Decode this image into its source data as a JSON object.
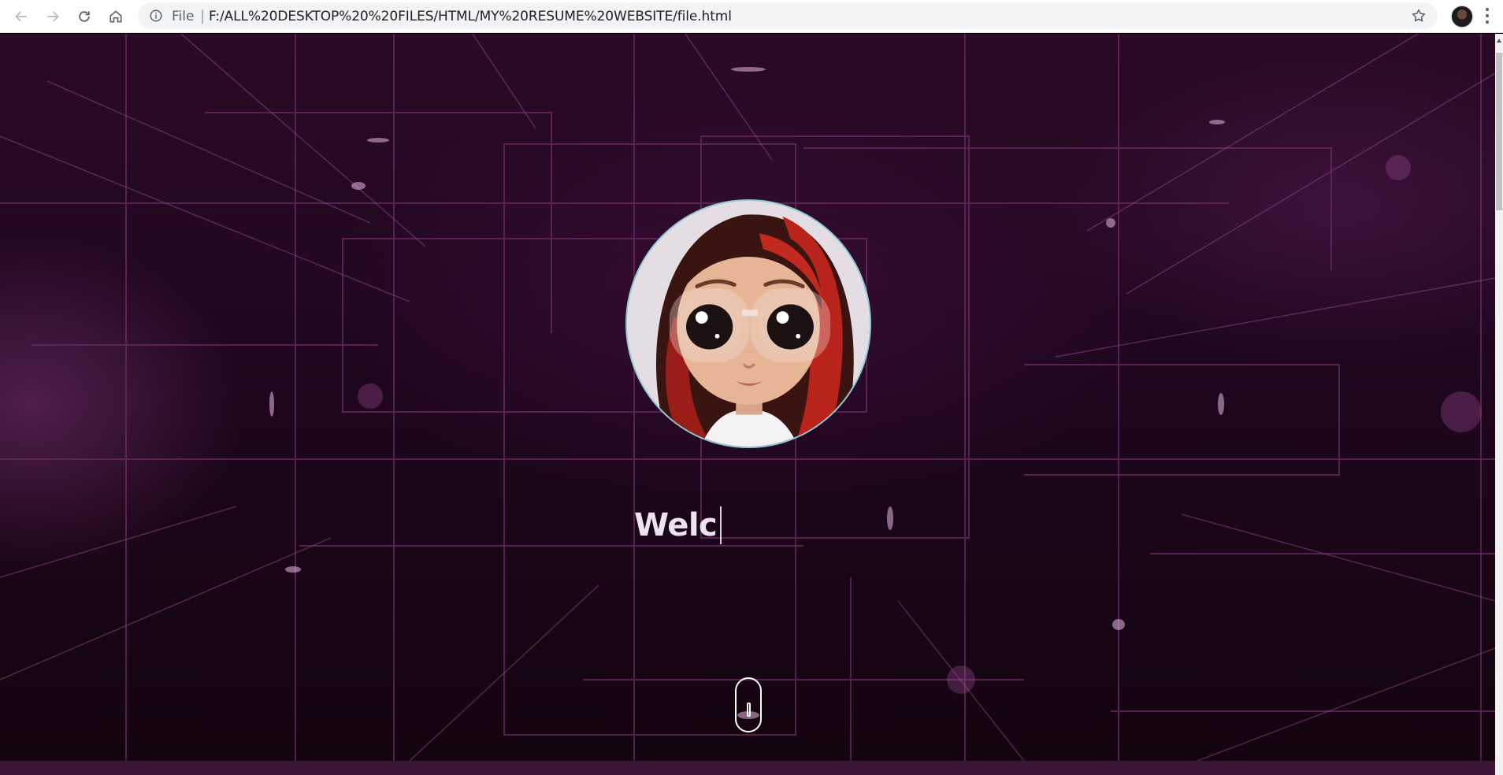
{
  "browser": {
    "scheme_label": "File",
    "separator": "|",
    "url": "F:/ALL%20DESKTOP%20%20FILES/HTML/MY%20RESUME%20WEBSITE/file.html",
    "icons": [
      "back-arrow-icon",
      "forward-arrow-icon",
      "reload-icon",
      "home-icon",
      "info-icon",
      "star-icon",
      "profile-avatar",
      "kebab-menu-icon"
    ]
  },
  "hero": {
    "typed_text": "Welc",
    "avatar_alt": "cartoon avatar with red hair and glasses",
    "scroll_indicator": "mouse-scroll-icon"
  },
  "colors": {
    "background": "#1a0617",
    "accent_purple": "#7b3a73",
    "ring": "#8fc9cf",
    "heading": "#ece3ef"
  }
}
